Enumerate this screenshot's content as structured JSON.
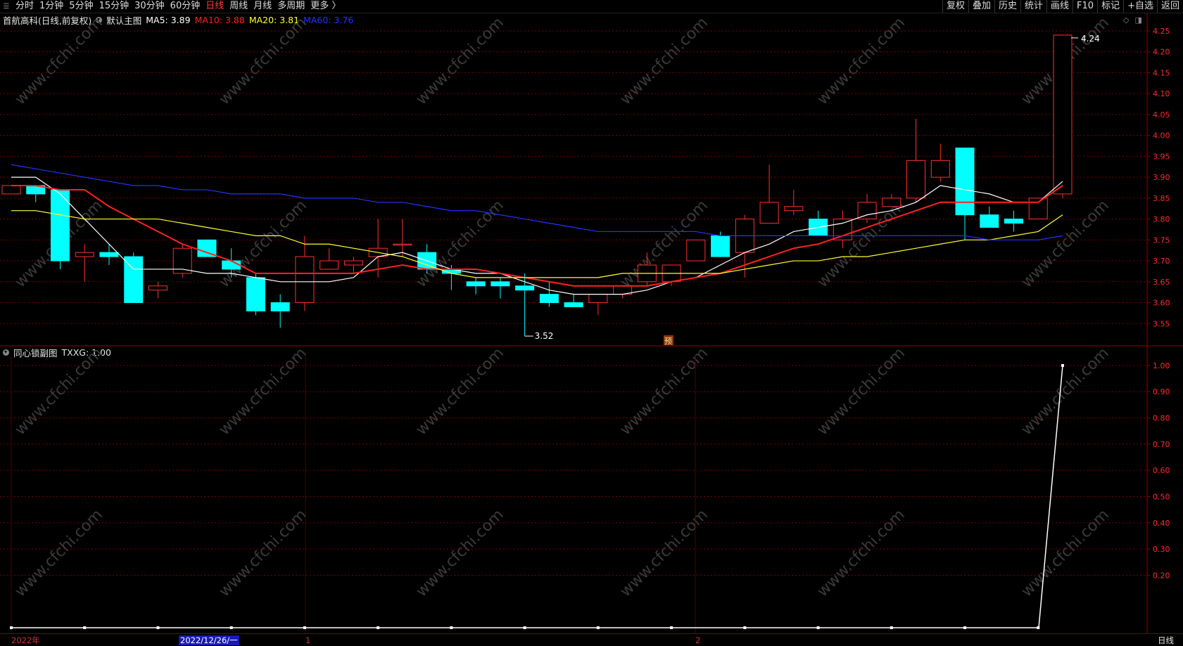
{
  "toolbar": {
    "menu_icon": "menu-icon",
    "periods": [
      "分时",
      "1分钟",
      "5分钟",
      "15分钟",
      "30分钟",
      "60分钟",
      "日线",
      "周线",
      "月线",
      "多周期",
      "更多 〉"
    ],
    "active_period": "日线",
    "right_buttons": [
      "复权",
      "叠加",
      "历史",
      "统计",
      "画线",
      "F10",
      "标记",
      "+自选",
      "返回"
    ]
  },
  "main_legend": {
    "title": "首航高科(日线,前复权)",
    "indicator": "默认主图",
    "items": [
      {
        "label": "MA5: 3.89",
        "color": "#ffffff"
      },
      {
        "label": "MA10: 3.88",
        "color": "#ff2020"
      },
      {
        "label": "MA20: 3.81",
        "color": "#ffff33"
      },
      {
        "label": "MA60: 3.76",
        "color": "#2233ff"
      }
    ]
  },
  "sub_legend": {
    "title": "同心锁副图",
    "value": "TXXG: 1.00"
  },
  "annotations": {
    "high_label": "4.24",
    "low_label": "3.52",
    "forecast_badge": "预"
  },
  "bottom_axis": {
    "labels": [
      {
        "text": "2022年",
        "color": "#cc3333"
      },
      {
        "text": "2022/12/26/一",
        "color": "#ffffff",
        "highlight": true
      },
      {
        "text": "1",
        "color": "#cc3333"
      },
      {
        "text": "2",
        "color": "#cc3333"
      }
    ],
    "corner": "日线"
  },
  "watermark": "www.cfchi.com",
  "colors": {
    "up": "#ff3030",
    "down": "#00ffff",
    "grid": "#7a0000",
    "axis_text": "#ff2b2b",
    "ma5": "#ffffff",
    "ma10": "#ff2020",
    "ma20": "#ffff33",
    "ma60": "#2233ff"
  },
  "chart_data": [
    {
      "type": "candlestick",
      "title": "首航高科(日线,前复权)",
      "y_ticks": [
        3.55,
        3.6,
        3.65,
        3.7,
        3.75,
        3.8,
        3.85,
        3.9,
        3.95,
        4.0,
        4.05,
        4.1,
        4.15,
        4.2,
        4.25
      ],
      "ylim": [
        3.5,
        4.26
      ],
      "candles": [
        {
          "o": 3.86,
          "h": 3.88,
          "l": 3.86,
          "c": 3.88
        },
        {
          "o": 3.88,
          "h": 3.88,
          "l": 3.84,
          "c": 3.86
        },
        {
          "o": 3.87,
          "h": 3.87,
          "l": 3.68,
          "c": 3.7
        },
        {
          "o": 3.71,
          "h": 3.74,
          "l": 3.65,
          "c": 3.72
        },
        {
          "o": 3.72,
          "h": 3.74,
          "l": 3.69,
          "c": 3.71
        },
        {
          "o": 3.71,
          "h": 3.72,
          "l": 3.6,
          "c": 3.6
        },
        {
          "o": 3.63,
          "h": 3.65,
          "l": 3.61,
          "c": 3.64
        },
        {
          "o": 3.67,
          "h": 3.74,
          "l": 3.66,
          "c": 3.73
        },
        {
          "o": 3.75,
          "h": 3.75,
          "l": 3.71,
          "c": 3.71
        },
        {
          "o": 3.7,
          "h": 3.73,
          "l": 3.66,
          "c": 3.68
        },
        {
          "o": 3.66,
          "h": 3.67,
          "l": 3.57,
          "c": 3.58
        },
        {
          "o": 3.6,
          "h": 3.62,
          "l": 3.54,
          "c": 3.58
        },
        {
          "o": 3.6,
          "h": 3.76,
          "l": 3.58,
          "c": 3.71
        },
        {
          "o": 3.68,
          "h": 3.73,
          "l": 3.68,
          "c": 3.7
        },
        {
          "o": 3.69,
          "h": 3.71,
          "l": 3.67,
          "c": 3.7
        },
        {
          "o": 3.71,
          "h": 3.8,
          "l": 3.66,
          "c": 3.73
        },
        {
          "o": 3.74,
          "h": 3.8,
          "l": 3.71,
          "c": 3.74
        },
        {
          "o": 3.72,
          "h": 3.74,
          "l": 3.67,
          "c": 3.68
        },
        {
          "o": 3.68,
          "h": 3.69,
          "l": 3.63,
          "c": 3.67
        },
        {
          "o": 3.65,
          "h": 3.66,
          "l": 3.62,
          "c": 3.64
        },
        {
          "o": 3.65,
          "h": 3.66,
          "l": 3.61,
          "c": 3.64
        },
        {
          "o": 3.64,
          "h": 3.67,
          "l": 3.52,
          "c": 3.63
        },
        {
          "o": 3.62,
          "h": 3.65,
          "l": 3.59,
          "c": 3.6
        },
        {
          "o": 3.6,
          "h": 3.62,
          "l": 3.59,
          "c": 3.59
        },
        {
          "o": 3.6,
          "h": 3.62,
          "l": 3.57,
          "c": 3.62
        },
        {
          "o": 3.62,
          "h": 3.64,
          "l": 3.61,
          "c": 3.64
        },
        {
          "o": 3.65,
          "h": 3.72,
          "l": 3.64,
          "c": 3.69
        },
        {
          "o": 3.65,
          "h": 3.69,
          "l": 3.64,
          "c": 3.69
        },
        {
          "o": 3.7,
          "h": 3.75,
          "l": 3.7,
          "c": 3.75
        },
        {
          "o": 3.76,
          "h": 3.77,
          "l": 3.71,
          "c": 3.71
        },
        {
          "o": 3.72,
          "h": 3.81,
          "l": 3.66,
          "c": 3.8
        },
        {
          "o": 3.79,
          "h": 3.93,
          "l": 3.79,
          "c": 3.84
        },
        {
          "o": 3.82,
          "h": 3.87,
          "l": 3.81,
          "c": 3.83
        },
        {
          "o": 3.8,
          "h": 3.82,
          "l": 3.76,
          "c": 3.76
        },
        {
          "o": 3.75,
          "h": 3.82,
          "l": 3.73,
          "c": 3.8
        },
        {
          "o": 3.8,
          "h": 3.86,
          "l": 3.79,
          "c": 3.84
        },
        {
          "o": 3.83,
          "h": 3.86,
          "l": 3.83,
          "c": 3.85
        },
        {
          "o": 3.85,
          "h": 4.04,
          "l": 3.84,
          "c": 3.94
        },
        {
          "o": 3.9,
          "h": 3.98,
          "l": 3.89,
          "c": 3.94
        },
        {
          "o": 3.97,
          "h": 3.97,
          "l": 3.75,
          "c": 3.81
        },
        {
          "o": 3.81,
          "h": 3.83,
          "l": 3.78,
          "c": 3.78
        },
        {
          "o": 3.8,
          "h": 3.82,
          "l": 3.77,
          "c": 3.79
        },
        {
          "o": 3.8,
          "h": 3.85,
          "l": 3.8,
          "c": 3.85
        },
        {
          "o": 3.86,
          "h": 4.24,
          "l": 3.85,
          "c": 4.24
        }
      ],
      "series": [
        {
          "name": "MA5",
          "values": [
            3.9,
            3.9,
            3.86,
            3.8,
            3.74,
            3.68,
            3.68,
            3.68,
            3.67,
            3.67,
            3.66,
            3.65,
            3.65,
            3.65,
            3.66,
            3.71,
            3.72,
            3.7,
            3.68,
            3.67,
            3.67,
            3.65,
            3.63,
            3.62,
            3.62,
            3.62,
            3.63,
            3.65,
            3.66,
            3.69,
            3.72,
            3.74,
            3.77,
            3.78,
            3.79,
            3.81,
            3.82,
            3.84,
            3.88,
            3.87,
            3.86,
            3.84,
            3.84,
            3.89
          ]
        },
        {
          "name": "MA10",
          "values": [
            3.88,
            3.88,
            3.87,
            3.87,
            3.83,
            3.8,
            3.77,
            3.74,
            3.72,
            3.7,
            3.67,
            3.67,
            3.67,
            3.67,
            3.67,
            3.68,
            3.69,
            3.68,
            3.68,
            3.68,
            3.67,
            3.66,
            3.65,
            3.64,
            3.64,
            3.64,
            3.64,
            3.65,
            3.66,
            3.67,
            3.69,
            3.71,
            3.73,
            3.74,
            3.76,
            3.78,
            3.8,
            3.82,
            3.84,
            3.84,
            3.84,
            3.84,
            3.84,
            3.88
          ]
        },
        {
          "name": "MA20",
          "values": [
            3.82,
            3.82,
            3.81,
            3.8,
            3.8,
            3.8,
            3.8,
            3.79,
            3.78,
            3.77,
            3.76,
            3.76,
            3.74,
            3.74,
            3.73,
            3.72,
            3.71,
            3.69,
            3.67,
            3.66,
            3.66,
            3.66,
            3.66,
            3.66,
            3.66,
            3.67,
            3.67,
            3.67,
            3.67,
            3.67,
            3.68,
            3.69,
            3.7,
            3.7,
            3.71,
            3.71,
            3.72,
            3.73,
            3.74,
            3.75,
            3.75,
            3.76,
            3.77,
            3.81
          ]
        },
        {
          "name": "MA60",
          "values": [
            3.93,
            3.92,
            3.91,
            3.9,
            3.89,
            3.88,
            3.88,
            3.87,
            3.87,
            3.86,
            3.86,
            3.86,
            3.85,
            3.85,
            3.85,
            3.84,
            3.84,
            3.83,
            3.82,
            3.82,
            3.81,
            3.8,
            3.79,
            3.78,
            3.77,
            3.77,
            3.77,
            3.77,
            3.77,
            3.76,
            3.76,
            3.76,
            3.76,
            3.76,
            3.76,
            3.76,
            3.76,
            3.76,
            3.76,
            3.76,
            3.75,
            3.75,
            3.75,
            3.76
          ]
        }
      ]
    },
    {
      "type": "line",
      "title": "同心锁副图",
      "y_ticks": [
        0.2,
        0.3,
        0.4,
        0.5,
        0.6,
        0.7,
        0.8,
        0.9,
        1.0
      ],
      "ylim": [
        0,
        1.04
      ],
      "series": [
        {
          "name": "TXXG",
          "values": [
            0,
            0,
            0,
            0,
            0,
            0,
            0,
            0,
            0,
            0,
            0,
            0,
            0,
            0,
            0,
            0,
            0,
            0,
            0,
            0,
            0,
            0,
            0,
            0,
            0,
            0,
            0,
            0,
            0,
            0,
            0,
            0,
            0,
            0,
            0,
            0,
            0,
            0,
            0,
            0,
            0,
            0,
            0,
            1.0
          ]
        }
      ],
      "markers_every": 3
    }
  ]
}
